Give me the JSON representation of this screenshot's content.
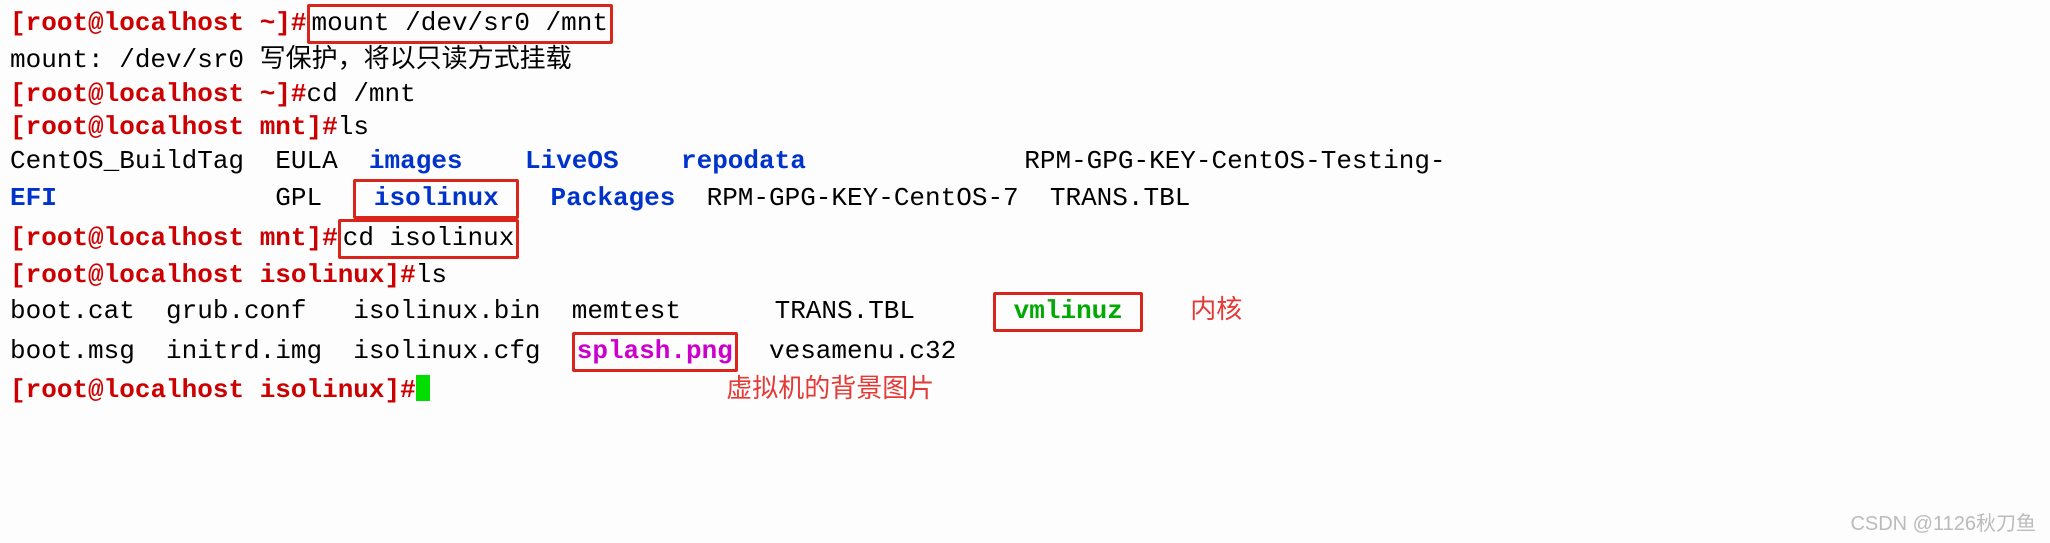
{
  "prompt": {
    "user": "root",
    "at": "@",
    "host": "localhost",
    "dir_home": "~",
    "dir_mnt": "mnt",
    "dir_isolinux": "isolinux",
    "end": "#"
  },
  "cmds": {
    "mount": "mount /dev/sr0 /mnt",
    "mount_out": "mount: /dev/sr0 写保护，将以只读方式挂载",
    "cd_mnt": "cd /mnt",
    "ls1": "ls",
    "cd_iso": "cd isolinux",
    "ls2": "ls"
  },
  "ls_mnt": {
    "r1": [
      "CentOS_BuildTag",
      "EULA",
      "images",
      "LiveOS",
      "repodata",
      "RPM-GPG-KEY-CentOS-Testing-"
    ],
    "r2": [
      "EFI",
      "GPL",
      "isolinux",
      "Packages",
      "RPM-GPG-KEY-CentOS-7",
      "TRANS.TBL"
    ]
  },
  "ls_iso": {
    "r1": [
      "boot.cat",
      "grub.conf",
      "isolinux.bin",
      "memtest",
      "TRANS.TBL",
      "vmlinuz",
      "内核"
    ],
    "r2": [
      "boot.msg",
      "initrd.img",
      "isolinux.cfg",
      "splash.png",
      "vesamenu.c32"
    ]
  },
  "annot": {
    "bg": "虚拟机的背景图片"
  },
  "watermark": "CSDN @1126秋刀鱼"
}
